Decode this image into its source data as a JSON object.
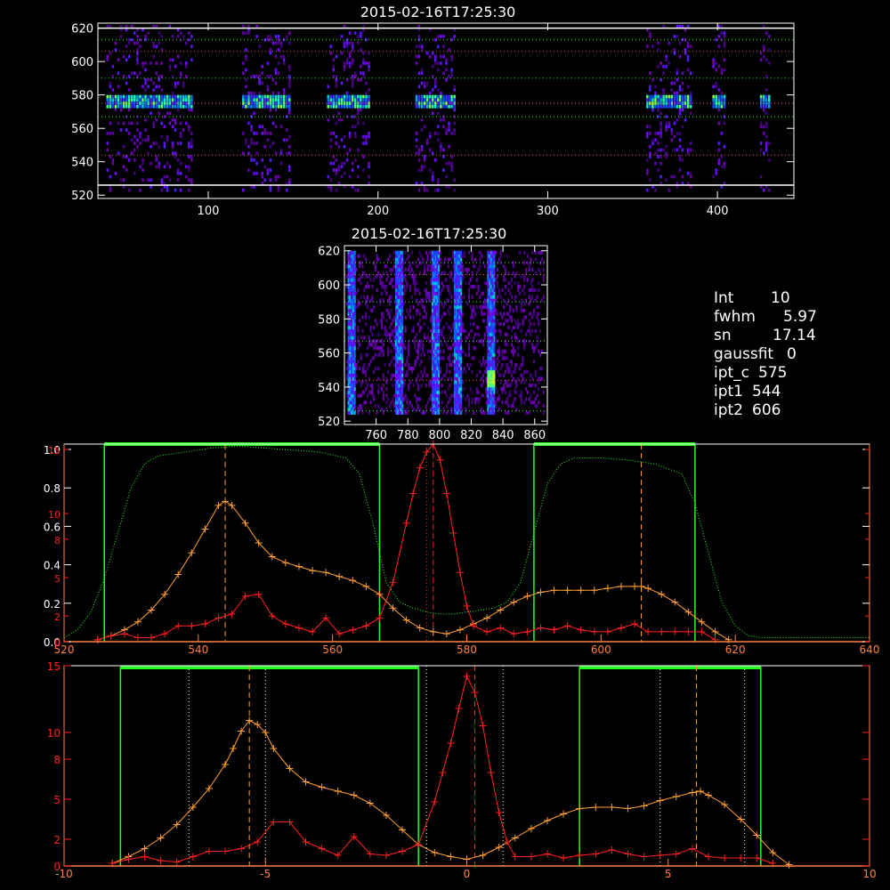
{
  "colors": {
    "background": "#000000",
    "axes": "#ffffff",
    "red": "#ff2020",
    "orange": "#ffa030",
    "green": "#20ff20",
    "spectral_axis": "#ff8040",
    "marker_dot": "#ff6060"
  },
  "panels": {
    "top_title": "2015-02-16T17:25:30",
    "mid_title": "2015-02-16T17:25:30"
  },
  "info": {
    "int_label": "Int",
    "int_value": "10",
    "fwhm_label": "fwhm",
    "fwhm_value": "5.97",
    "sn_label": "sn",
    "sn_value": "17.14",
    "gaussfit_label": "gaussfit",
    "gaussfit_value": "0",
    "ipt_c_label": "ipt_c",
    "ipt_c_value": "575",
    "ipt1_label": "ipt1",
    "ipt1_value": "544",
    "ipt2_label": "ipt2",
    "ipt2_value": "606"
  },
  "chart_data": [
    {
      "type": "heatmap",
      "title": "2015-02-16T17:25:30",
      "xlim": [
        35,
        445
      ],
      "ylim": [
        518,
        623
      ],
      "x_ticks": [
        "100",
        "200",
        "300",
        "400"
      ],
      "x_tick_values": [
        100,
        200,
        300,
        400
      ],
      "y_ticks": [
        "520",
        "540",
        "560",
        "580",
        "600",
        "620"
      ],
      "y_tick_values": [
        520,
        540,
        560,
        580,
        600,
        620
      ],
      "horizontal_lines": {
        "green_dotted": [
          526,
          567,
          590,
          613
        ],
        "red_dotted": [
          544,
          575,
          606
        ],
        "white_solid": [
          526,
          620
        ]
      },
      "exposure_bands_x": [
        [
          40,
          90
        ],
        [
          120,
          148
        ],
        [
          170,
          195
        ],
        [
          222,
          245
        ],
        [
          358,
          385
        ],
        [
          397,
          405
        ],
        [
          425,
          430
        ]
      ],
      "bright_row_y": 575
    },
    {
      "type": "heatmap",
      "title": "2015-02-16T17:25:30",
      "xlim": [
        740,
        868
      ],
      "ylim": [
        518,
        623
      ],
      "x_ticks": [
        "760",
        "780",
        "800",
        "820",
        "840",
        "860"
      ],
      "x_tick_values": [
        760,
        780,
        800,
        820,
        840,
        860
      ],
      "y_ticks": [
        "520",
        "540",
        "560",
        "580",
        "600",
        "620"
      ],
      "y_tick_values": [
        520,
        540,
        560,
        580,
        600,
        620
      ],
      "horizontal_lines": {
        "green_dotted": [
          526,
          567,
          590,
          613
        ],
        "red_dotted": [
          544,
          606
        ]
      },
      "bright_columns_x": [
        744,
        774,
        797,
        811,
        832
      ],
      "hot_spot": [
        832,
        544
      ]
    },
    {
      "type": "line",
      "xlim": [
        520,
        640
      ],
      "x_ticks": [
        "520",
        "540",
        "560",
        "580",
        "600",
        "620",
        "640"
      ],
      "x_tick_values": [
        520,
        540,
        560,
        580,
        600,
        620,
        640
      ],
      "y_left_ticks_white": [
        "0.0",
        "0.2",
        "0.4",
        "0.6",
        "0.8",
        "1.0"
      ],
      "y_left_tick_values_white": [
        0,
        0.2,
        0.4,
        0.6,
        0.8,
        1.0
      ],
      "y_left_ticks_red": [
        "0",
        "2",
        "5",
        "8",
        "10",
        "15"
      ],
      "y_left_tick_values_red": [
        0,
        2,
        5,
        8,
        10,
        15
      ],
      "ylim": [
        0,
        1.0
      ],
      "green_boxes": [
        [
          526,
          567
        ],
        [
          590,
          614
        ]
      ],
      "vlines": {
        "orange_dashed": [
          544,
          606
        ],
        "red_dashed": [
          575
        ],
        "red_dotted": [
          574
        ]
      },
      "series": [
        {
          "color": "orange",
          "x": [
            525,
            527,
            529,
            531,
            533,
            535,
            537,
            539,
            541,
            543,
            544,
            545,
            547,
            549,
            551,
            553,
            555,
            557,
            559,
            561,
            563,
            565,
            567,
            569,
            571,
            573,
            575,
            577,
            579,
            581,
            583,
            585,
            587,
            589,
            591,
            593,
            595,
            597,
            599,
            601,
            603,
            605,
            606,
            607,
            609,
            611,
            613,
            615,
            617,
            619
          ],
          "y": [
            0.01,
            0.03,
            0.06,
            0.1,
            0.16,
            0.24,
            0.34,
            0.45,
            0.57,
            0.69,
            0.71,
            0.69,
            0.6,
            0.5,
            0.43,
            0.4,
            0.38,
            0.36,
            0.35,
            0.33,
            0.31,
            0.28,
            0.24,
            0.17,
            0.11,
            0.07,
            0.05,
            0.04,
            0.06,
            0.09,
            0.12,
            0.16,
            0.2,
            0.23,
            0.25,
            0.26,
            0.26,
            0.26,
            0.26,
            0.27,
            0.28,
            0.28,
            0.28,
            0.27,
            0.24,
            0.2,
            0.15,
            0.1,
            0.05,
            0.01
          ]
        },
        {
          "color": "red",
          "x": [
            525,
            527,
            529,
            531,
            533,
            535,
            537,
            539,
            541,
            543,
            545,
            547,
            549,
            551,
            553,
            555,
            557,
            559,
            561,
            563,
            565,
            567,
            569,
            571,
            572,
            573,
            574,
            575,
            576,
            577,
            578,
            579,
            580,
            581,
            583,
            585,
            587,
            589,
            591,
            593,
            595,
            597,
            599,
            601,
            603,
            605,
            607,
            609,
            611,
            613,
            615,
            617
          ],
          "y": [
            0.01,
            0.03,
            0.04,
            0.02,
            0.02,
            0.04,
            0.08,
            0.08,
            0.09,
            0.12,
            0.14,
            0.23,
            0.24,
            0.13,
            0.09,
            0.07,
            0.05,
            0.12,
            0.04,
            0.06,
            0.08,
            0.12,
            0.3,
            0.6,
            0.75,
            0.88,
            0.96,
            1.0,
            0.92,
            0.75,
            0.55,
            0.35,
            0.18,
            0.08,
            0.05,
            0.07,
            0.04,
            0.05,
            0.07,
            0.06,
            0.08,
            0.06,
            0.05,
            0.05,
            0.07,
            0.09,
            0.05,
            0.05,
            0.05,
            0.05,
            0.05,
            0.01
          ]
        },
        {
          "color": "green",
          "style": "dotted",
          "x": [
            520,
            522,
            524,
            526,
            528,
            530,
            532,
            534,
            538,
            542,
            546,
            550,
            554,
            558,
            562,
            564,
            566,
            568,
            570,
            572,
            574,
            576,
            578,
            580,
            582,
            584,
            586,
            588,
            590,
            592,
            594,
            596,
            600,
            604,
            608,
            612,
            614,
            616,
            618,
            620,
            622,
            624,
            628,
            632,
            636,
            640
          ],
          "y": [
            0.02,
            0.06,
            0.15,
            0.32,
            0.55,
            0.78,
            0.9,
            0.94,
            0.96,
            0.98,
            0.99,
            0.98,
            0.97,
            0.96,
            0.93,
            0.85,
            0.6,
            0.3,
            0.2,
            0.17,
            0.15,
            0.14,
            0.14,
            0.15,
            0.16,
            0.17,
            0.2,
            0.3,
            0.55,
            0.8,
            0.9,
            0.93,
            0.93,
            0.92,
            0.9,
            0.85,
            0.7,
            0.45,
            0.2,
            0.08,
            0.03,
            0.02,
            0.02,
            0.02,
            0.02,
            0.02
          ]
        }
      ]
    },
    {
      "type": "line",
      "xlim": [
        -10,
        10
      ],
      "x_ticks": [
        "-10",
        "-5",
        "0",
        "5",
        "10"
      ],
      "x_tick_values": [
        -10,
        -5,
        0,
        5,
        10
      ],
      "y_left_ticks_red": [
        "0",
        "2",
        "5",
        "8",
        "10",
        "15"
      ],
      "y_left_tick_values_red": [
        0,
        2,
        5,
        8,
        10,
        15
      ],
      "ylim": [
        0,
        15
      ],
      "green_boxes": [
        [
          -8.6,
          -1.2
        ],
        [
          2.8,
          7.3
        ]
      ],
      "vlines": {
        "orange_dashed": [
          -5.4,
          5.7
        ],
        "red_dashed": [
          0.2
        ],
        "white_dotted": [
          -6.9,
          -5.0,
          -1.0,
          0.9,
          4.8,
          6.9
        ]
      },
      "series": [
        {
          "color": "orange",
          "x": [
            -8.8,
            -8.4,
            -8.0,
            -7.6,
            -7.2,
            -6.8,
            -6.4,
            -6.0,
            -5.8,
            -5.6,
            -5.4,
            -5.2,
            -5.0,
            -4.8,
            -4.4,
            -4.0,
            -3.6,
            -3.2,
            -2.8,
            -2.4,
            -2.0,
            -1.6,
            -1.2,
            -0.8,
            -0.4,
            0.0,
            0.4,
            0.8,
            1.2,
            1.6,
            2.0,
            2.4,
            2.8,
            3.2,
            3.6,
            4.0,
            4.4,
            4.8,
            5.2,
            5.6,
            5.8,
            6.0,
            6.4,
            6.8,
            7.2,
            7.6,
            8.0
          ],
          "y": [
            0.2,
            0.7,
            1.3,
            2.1,
            3.1,
            4.4,
            5.8,
            7.6,
            8.8,
            10.1,
            10.9,
            10.6,
            10.0,
            8.8,
            7.3,
            6.3,
            5.9,
            5.6,
            5.3,
            4.7,
            3.8,
            2.7,
            1.6,
            1.0,
            0.7,
            0.5,
            0.8,
            1.4,
            2.1,
            2.8,
            3.4,
            3.9,
            4.3,
            4.4,
            4.4,
            4.3,
            4.5,
            4.9,
            5.2,
            5.5,
            5.6,
            5.3,
            4.6,
            3.5,
            2.3,
            1.0,
            0.1
          ]
        },
        {
          "color": "red",
          "x": [
            -8.8,
            -8.4,
            -8.0,
            -7.6,
            -7.2,
            -6.8,
            -6.4,
            -6.0,
            -5.6,
            -5.2,
            -4.8,
            -4.4,
            -4.0,
            -3.6,
            -3.2,
            -2.8,
            -2.4,
            -2.0,
            -1.6,
            -1.2,
            -0.8,
            -0.6,
            -0.4,
            -0.2,
            0.0,
            0.2,
            0.4,
            0.6,
            0.8,
            1.0,
            1.2,
            1.6,
            2.0,
            2.4,
            2.8,
            3.2,
            3.6,
            4.0,
            4.4,
            4.8,
            5.2,
            5.6,
            6.0,
            6.4,
            6.8,
            7.2,
            7.6
          ],
          "y": [
            0.2,
            0.5,
            0.7,
            0.4,
            0.3,
            0.7,
            1.1,
            1.1,
            1.3,
            1.8,
            3.3,
            3.3,
            1.8,
            1.3,
            0.8,
            2.2,
            0.9,
            0.8,
            1.1,
            1.6,
            4.8,
            7.0,
            9.2,
            11.8,
            14.2,
            13.0,
            10.5,
            7.0,
            4.0,
            1.8,
            0.7,
            0.7,
            0.9,
            0.6,
            0.8,
            0.9,
            1.2,
            0.9,
            0.7,
            0.8,
            0.9,
            1.3,
            0.7,
            0.6,
            0.6,
            0.6,
            0.2
          ]
        }
      ]
    }
  ]
}
